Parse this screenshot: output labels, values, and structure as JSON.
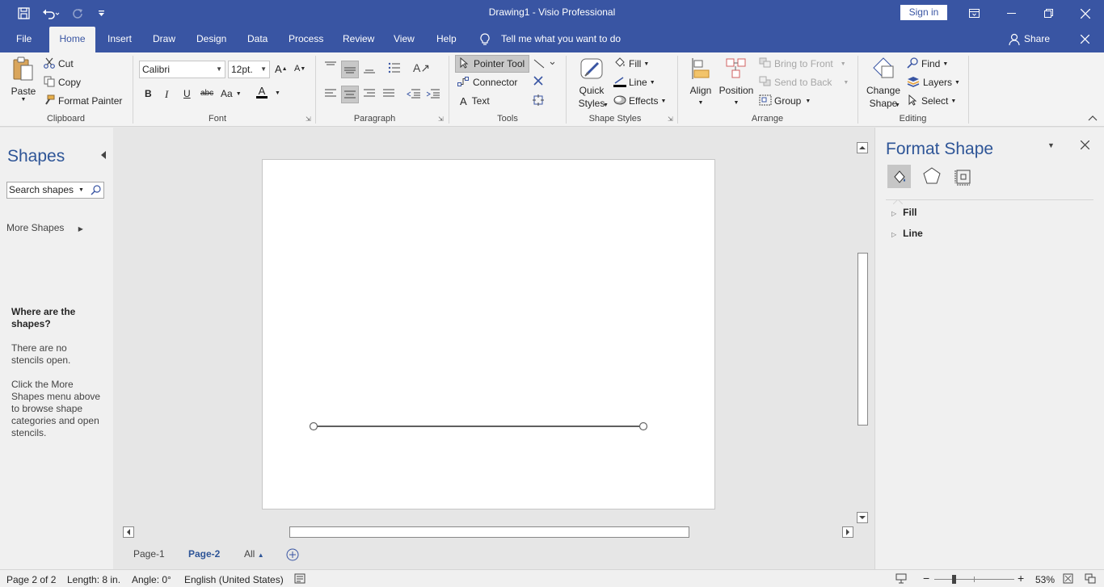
{
  "titlebar": {
    "title": "Drawing1  -  Visio Professional",
    "signin_label": "Sign in"
  },
  "tabs": [
    {
      "label": "File"
    },
    {
      "label": "Home",
      "active": true
    },
    {
      "label": "Insert"
    },
    {
      "label": "Draw"
    },
    {
      "label": "Design"
    },
    {
      "label": "Data"
    },
    {
      "label": "Process"
    },
    {
      "label": "Review"
    },
    {
      "label": "View"
    },
    {
      "label": "Help"
    }
  ],
  "tell_me": "Tell me what you want to do",
  "share_label": "Share",
  "ribbon": {
    "clipboard": {
      "label": "Clipboard",
      "paste": "Paste",
      "cut": "Cut",
      "copy": "Copy",
      "format_painter": "Format Painter"
    },
    "font": {
      "label": "Font",
      "family": "Calibri",
      "size": "12pt.",
      "case_label": "Aa"
    },
    "paragraph": {
      "label": "Paragraph"
    },
    "tools": {
      "label": "Tools",
      "pointer": "Pointer Tool",
      "connector": "Connector",
      "text": "Text"
    },
    "shape_styles": {
      "label": "Shape Styles",
      "quick_styles_1": "Quick",
      "quick_styles_2": "Styles",
      "fill": "Fill",
      "line": "Line",
      "effects": "Effects"
    },
    "arrange": {
      "label": "Arrange",
      "align": "Align",
      "position": "Position",
      "bring_to_front": "Bring to Front",
      "send_to_back": "Send to Back",
      "group": "Group"
    },
    "editing": {
      "label": "Editing",
      "change_shape_1": "Change",
      "change_shape_2": "Shape",
      "find": "Find",
      "layers": "Layers",
      "select": "Select"
    }
  },
  "shapes_panel": {
    "title": "Shapes",
    "search_placeholder": "Search shapes",
    "more_shapes": "More Shapes",
    "help_heading": "Where are the shapes?",
    "help_p1": "There are no stencils open.",
    "help_p2": "Click the More Shapes menu above to browse shape categories and open stencils."
  },
  "page_tabs": [
    {
      "label": "Page-1"
    },
    {
      "label": "Page-2",
      "active": true
    },
    {
      "label": "All"
    }
  ],
  "format_panel": {
    "title": "Format Shape",
    "sections": [
      "Fill",
      "Line"
    ]
  },
  "status": {
    "page": "Page 2 of 2",
    "length": "Length: 8 in.",
    "angle": "Angle: 0°",
    "language": "English (United States)",
    "zoom": "53%",
    "zoom_level": 0.53
  },
  "colors": {
    "brand_blue": "#3955a3",
    "heading_blue": "#2e5597",
    "ribbon_bg": "#f3f3f3",
    "canvas_bg": "#e6e6e6"
  }
}
